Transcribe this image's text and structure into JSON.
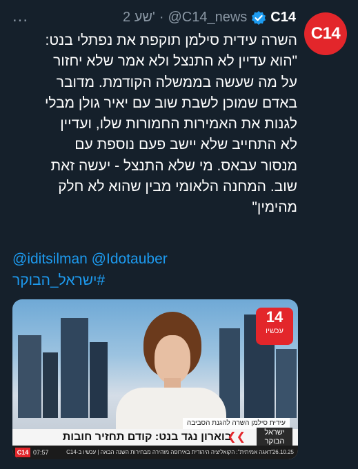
{
  "tweet": {
    "author_name": "C14",
    "handle": "@C14_news",
    "separator": "·",
    "time": "2 שע'",
    "avatar_text": "C14",
    "more": "...",
    "text": "השרה עידית סילמן תוקפת את נפתלי בנט:\n\"הוא עדיין לא התנצל ולא אמר שלא יחזור\nעל מה שעשה בממשלה הקודמת. מדובר\nבאדם שמוכן לשבת שוב עם יאיר גולן מבלי\nלגנות את האמירות החמורות שלו, ועדיין\nלא התחייב שלא יישב פעם נוספת עם\nמנסור עבאס. מי שלא התנצל - יעשה זאת\nשוב. המחנה הלאומי מבין שהוא לא חלק\nמהימין\"",
    "mentions": "@iditsilman @Idotauber",
    "hashtag": "#ישראל_הבוקר"
  },
  "media": {
    "channel_number": "14",
    "channel_sub": "עכשיו",
    "caption": "עידית סילמן  השרה להגנת הסביבה",
    "headline": "בוארון נגד בנט: קודם תחזיר חובות",
    "show_name": "ישראל הבוקר",
    "ticker_logo": "C14",
    "ticker_time": "07:57",
    "ticker_text": "\"דאגה אמיתית\": הקואליציה היהודית באירופה מזהירה מבחירות השנה הבאה | עכשיו ב-C14",
    "ticker_date": "26.10.25"
  },
  "colors": {
    "background": "#15202b",
    "link": "#1d9bf0",
    "muted": "#8b98a5",
    "brand": "#e3262b"
  }
}
